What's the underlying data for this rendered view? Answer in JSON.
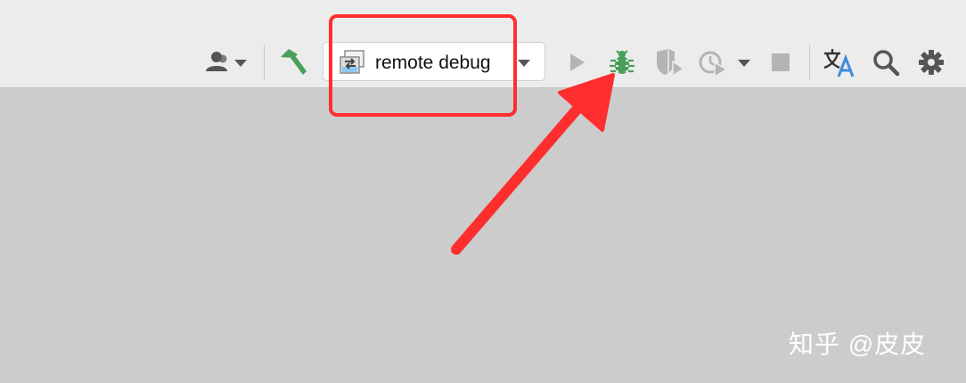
{
  "toolbar": {
    "run_configuration": {
      "label": "remote debug"
    },
    "icons": {
      "account": "user-icon",
      "build": "hammer-icon",
      "run": "play-icon",
      "debug": "bug-icon",
      "coverage": "coverage-icon",
      "profile": "profiler-icon",
      "stop": "stop-icon",
      "translate": "translate-icon",
      "search": "search-icon",
      "settings": "gear-icon"
    },
    "colors": {
      "debug_green": "#4a9f5a",
      "build_green": "#4a9f5a",
      "disabled_gray": "#b4b4b4",
      "icon_dark": "#555555",
      "translate_blue": "#3d8ddb"
    }
  },
  "annotation": {
    "highlight_color": "#ff2e2e",
    "arrow_color": "#ff2e2e"
  },
  "watermark": {
    "text": "知乎 @皮皮"
  }
}
